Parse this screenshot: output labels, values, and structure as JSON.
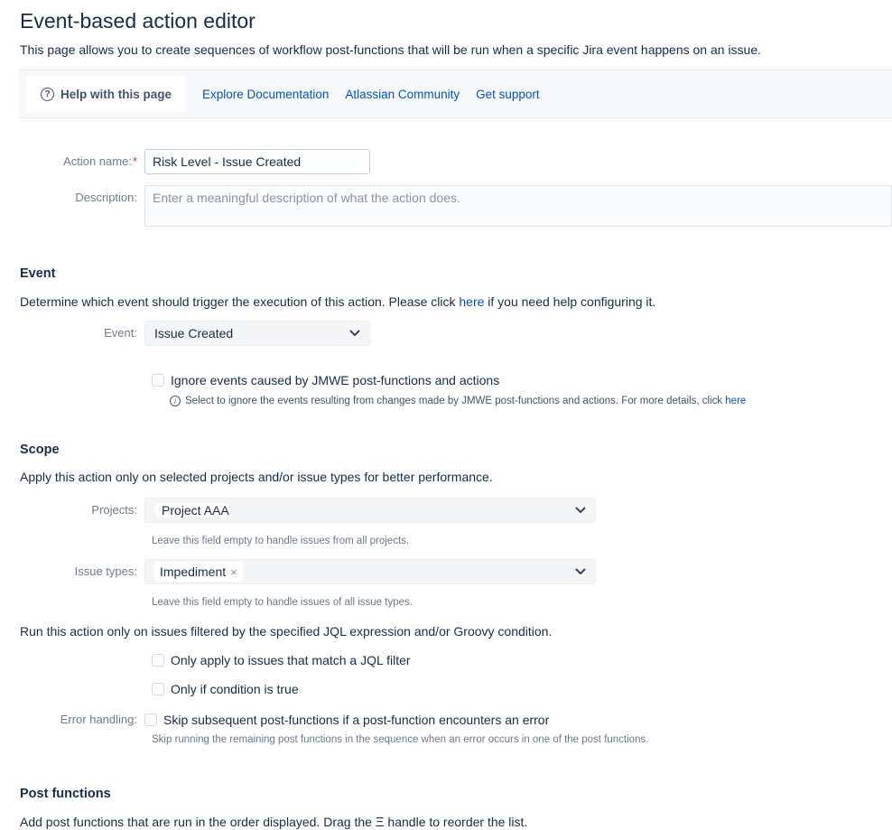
{
  "page": {
    "title": "Event-based action editor",
    "subtitle": "This page allows you to create sequences of workflow post-functions that will be run when a specific Jira event happens on an issue."
  },
  "help_bar": {
    "help_tab": "Help with this page",
    "links": [
      "Explore Documentation",
      "Atlassian Community",
      "Get support"
    ]
  },
  "icons": {
    "question": "?",
    "info": "i",
    "tag_remove": "×",
    "drag_handle": "Ξ"
  },
  "form": {
    "action_name": {
      "label": "Action name:",
      "required_mark": "*",
      "value": "Risk Level - Issue Created"
    },
    "description": {
      "label": "Description:",
      "placeholder": "Enter a meaningful description of what the action does."
    }
  },
  "event_section": {
    "heading": "Event",
    "intro_before_link": "Determine which event should trigger the execution of this action. Please click ",
    "intro_link": "here",
    "intro_after_link": " if you need help configuring it.",
    "event_label": "Event:",
    "event_value": "Issue Created",
    "ignore_checkbox_label": "Ignore events caused by JMWE post-functions and actions",
    "ignore_note_before_link": "Select to ignore the events resulting from changes made by JMWE post-functions and actions. For more details, click ",
    "ignore_note_link": "here"
  },
  "scope_section": {
    "heading": "Scope",
    "intro": "Apply this action only on selected projects and/or issue types for better performance.",
    "projects_label": "Projects:",
    "projects_value": "Project AAA",
    "projects_help": "Leave this field empty to handle issues from all projects.",
    "issue_types_label": "Issue types:",
    "issue_types_tag": "Impediment",
    "issue_types_help": "Leave this field empty to handle issues of all issue types.",
    "filter_intro": "Run this action only on issues filtered by the specified JQL expression and/or Groovy condition.",
    "jql_checkbox_label": "Only apply to issues that match a JQL filter",
    "condition_checkbox_label": "Only if condition is true",
    "error_handling_label": "Error handling:",
    "error_checkbox_label": "Skip subsequent post-functions if a post-function encounters an error",
    "error_help": "Skip running the remaining post functions in the sequence when an error occurs in one of the post functions."
  },
  "post_functions_section": {
    "heading": "Post functions",
    "intro_before_icon": "Add post functions that are run in the order displayed. Drag the ",
    "intro_after_icon": " handle to reorder the list."
  },
  "colors": {
    "link": "#0052cc",
    "required": "#de350b",
    "heading_text": "#172b4d",
    "label_text": "#6e7b91",
    "select_background": "#f4f5f7"
  }
}
